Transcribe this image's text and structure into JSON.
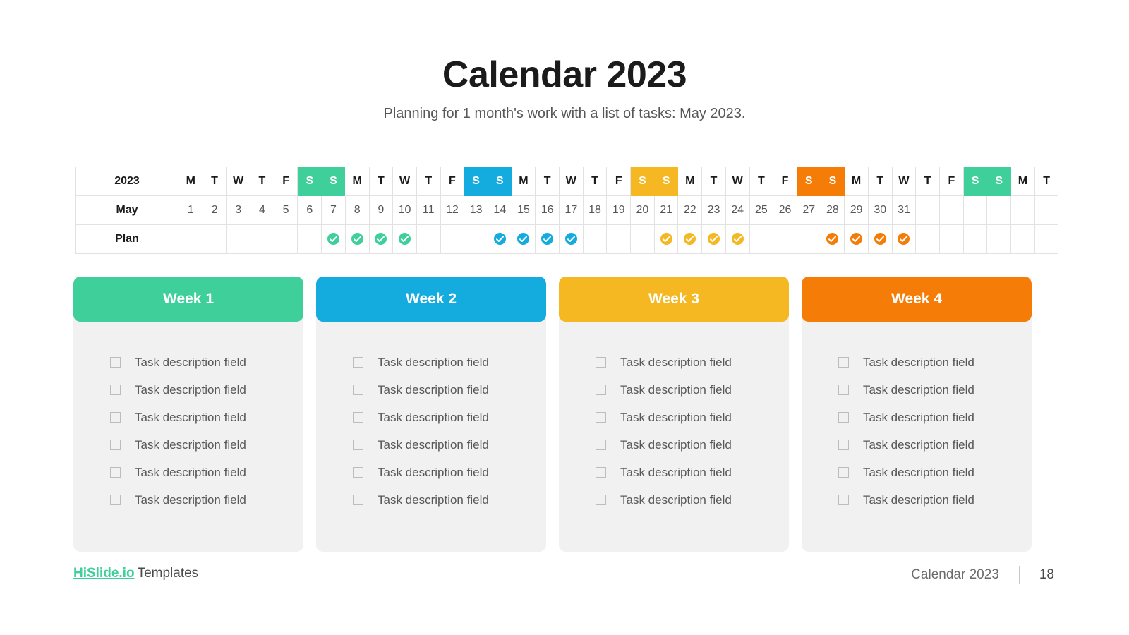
{
  "slide": {
    "title": "Calendar 2023",
    "subtitle": "Planning for 1 month's work with a list of tasks: May 2023."
  },
  "colors": {
    "week1": "#3ECF9A",
    "week2": "#14ABDF",
    "week3": "#F5B722",
    "week4": "#F57C06",
    "week5": "#3ECF9A",
    "weekend_shade": "#f0f0f0",
    "card_body": "#f1f1f1",
    "brand": "#3ECF9A"
  },
  "calendar": {
    "row_labels": {
      "year": "2023",
      "month": "May",
      "plan": "Plan"
    },
    "columns": [
      {
        "dow": "M",
        "date": "1",
        "hl": null,
        "weekend": false,
        "check": null
      },
      {
        "dow": "T",
        "date": "2",
        "hl": null,
        "weekend": false,
        "check": null
      },
      {
        "dow": "W",
        "date": "3",
        "hl": null,
        "weekend": false,
        "check": null
      },
      {
        "dow": "T",
        "date": "4",
        "hl": null,
        "weekend": false,
        "check": null
      },
      {
        "dow": "F",
        "date": "5",
        "hl": null,
        "weekend": false,
        "check": null
      },
      {
        "dow": "S",
        "date": "6",
        "hl": "#3ECF9A",
        "weekend": true,
        "check": null
      },
      {
        "dow": "S",
        "date": "7",
        "hl": "#3ECF9A",
        "weekend": true,
        "check": "#3ECF9A"
      },
      {
        "dow": "M",
        "date": "8",
        "hl": null,
        "weekend": false,
        "check": "#3ECF9A"
      },
      {
        "dow": "T",
        "date": "9",
        "hl": null,
        "weekend": false,
        "check": "#3ECF9A"
      },
      {
        "dow": "W",
        "date": "10",
        "hl": null,
        "weekend": false,
        "check": "#3ECF9A"
      },
      {
        "dow": "T",
        "date": "11",
        "hl": null,
        "weekend": false,
        "check": null
      },
      {
        "dow": "F",
        "date": "12",
        "hl": null,
        "weekend": false,
        "check": null
      },
      {
        "dow": "S",
        "date": "13",
        "hl": "#14ABDF",
        "weekend": true,
        "check": null
      },
      {
        "dow": "S",
        "date": "14",
        "hl": "#14ABDF",
        "weekend": true,
        "check": "#14ABDF"
      },
      {
        "dow": "M",
        "date": "15",
        "hl": null,
        "weekend": false,
        "check": "#14ABDF"
      },
      {
        "dow": "T",
        "date": "16",
        "hl": null,
        "weekend": false,
        "check": "#14ABDF"
      },
      {
        "dow": "W",
        "date": "17",
        "hl": null,
        "weekend": false,
        "check": "#14ABDF"
      },
      {
        "dow": "T",
        "date": "18",
        "hl": null,
        "weekend": false,
        "check": null
      },
      {
        "dow": "F",
        "date": "19",
        "hl": null,
        "weekend": false,
        "check": null
      },
      {
        "dow": "S",
        "date": "20",
        "hl": "#F5B722",
        "weekend": true,
        "check": null
      },
      {
        "dow": "S",
        "date": "21",
        "hl": "#F5B722",
        "weekend": true,
        "check": "#F5B722"
      },
      {
        "dow": "M",
        "date": "22",
        "hl": null,
        "weekend": false,
        "check": "#F5B722"
      },
      {
        "dow": "T",
        "date": "23",
        "hl": null,
        "weekend": false,
        "check": "#F5B722"
      },
      {
        "dow": "W",
        "date": "24",
        "hl": null,
        "weekend": false,
        "check": "#F5B722"
      },
      {
        "dow": "T",
        "date": "25",
        "hl": null,
        "weekend": false,
        "check": null
      },
      {
        "dow": "F",
        "date": "26",
        "hl": null,
        "weekend": false,
        "check": null
      },
      {
        "dow": "S",
        "date": "27",
        "hl": "#F57C06",
        "weekend": true,
        "check": null
      },
      {
        "dow": "S",
        "date": "28",
        "hl": "#F57C06",
        "weekend": true,
        "check": "#F57C06"
      },
      {
        "dow": "M",
        "date": "29",
        "hl": null,
        "weekend": false,
        "check": "#F57C06"
      },
      {
        "dow": "T",
        "date": "30",
        "hl": null,
        "weekend": false,
        "check": "#F57C06"
      },
      {
        "dow": "W",
        "date": "31",
        "hl": null,
        "weekend": false,
        "check": "#F57C06"
      },
      {
        "dow": "T",
        "date": "",
        "hl": null,
        "weekend": false,
        "check": null
      },
      {
        "dow": "F",
        "date": "",
        "hl": null,
        "weekend": false,
        "check": null
      },
      {
        "dow": "S",
        "date": "",
        "hl": "#3ECF9A",
        "weekend": true,
        "check": null
      },
      {
        "dow": "S",
        "date": "",
        "hl": "#3ECF9A",
        "weekend": true,
        "check": null
      },
      {
        "dow": "M",
        "date": "",
        "hl": null,
        "weekend": false,
        "check": null
      },
      {
        "dow": "T",
        "date": "",
        "hl": null,
        "weekend": false,
        "check": null
      }
    ]
  },
  "week_cards": [
    {
      "title": "Week 1",
      "color": "#3ECF9A",
      "tasks": [
        "Task description field",
        "Task description field",
        "Task description field",
        "Task description field",
        "Task description field",
        "Task description field"
      ]
    },
    {
      "title": "Week 2",
      "color": "#14ABDF",
      "tasks": [
        "Task description field",
        "Task description field",
        "Task description field",
        "Task description field",
        "Task description field",
        "Task description field"
      ]
    },
    {
      "title": "Week 3",
      "color": "#F5B722",
      "tasks": [
        "Task description field",
        "Task description field",
        "Task description field",
        "Task description field",
        "Task description field",
        "Task description field"
      ]
    },
    {
      "title": "Week 4",
      "color": "#F57C06",
      "tasks": [
        "Task description field",
        "Task description field",
        "Task description field",
        "Task description field",
        "Task description field",
        "Task description field"
      ]
    }
  ],
  "footer": {
    "brand": "HiSlide.io",
    "brand_suffix": "Templates",
    "deck_name": "Calendar 2023",
    "page_number": "18"
  }
}
